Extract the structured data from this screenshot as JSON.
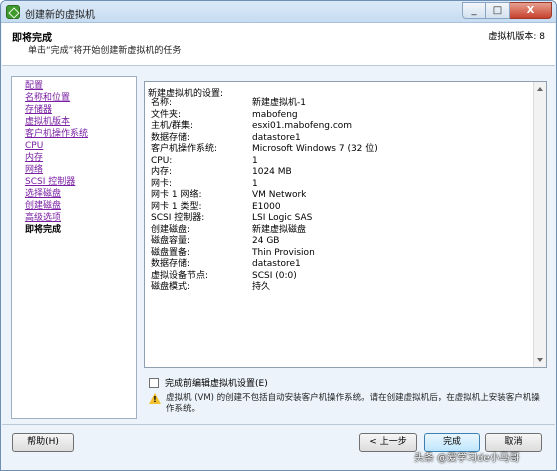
{
  "window": {
    "title": "创建新的虚拟机",
    "min_label": "_",
    "max_label": "□",
    "close_label": "X"
  },
  "header": {
    "title": "即将完成",
    "subtitle": "单击“完成”将开始创建新虚拟机的任务",
    "version": "虚拟机版本: 8"
  },
  "steps": [
    {
      "label": "配置"
    },
    {
      "label": "名称和位置"
    },
    {
      "label": "存储器"
    },
    {
      "label": "虚拟机版本"
    },
    {
      "label": "客户机操作系统"
    },
    {
      "label": "CPU"
    },
    {
      "label": "内存"
    },
    {
      "label": "网络"
    },
    {
      "label": "SCSI 控制器"
    },
    {
      "label": "选择磁盘"
    },
    {
      "label": "创建磁盘"
    },
    {
      "label": "高级选项"
    },
    {
      "label": "即将完成"
    }
  ],
  "summary": {
    "heading": "新建虚拟机的设置:",
    "rows": [
      {
        "key": "名称:",
        "value": "新建虚拟机-1"
      },
      {
        "key": "文件夹:",
        "value": "mabofeng"
      },
      {
        "key": "主机/群集:",
        "value": "esxi01.mabofeng.com"
      },
      {
        "key": "数据存储:",
        "value": "datastore1"
      },
      {
        "key": "客户机操作系统:",
        "value": "Microsoft Windows 7 (32 位)"
      },
      {
        "key": "CPU:",
        "value": "1"
      },
      {
        "key": "内存:",
        "value": "1024 MB"
      },
      {
        "key": "网卡:",
        "value": "1"
      },
      {
        "key": "网卡 1 网络:",
        "value": "VM Network"
      },
      {
        "key": "网卡 1 类型:",
        "value": "E1000"
      },
      {
        "key": "SCSI 控制器:",
        "value": "LSI Logic SAS"
      },
      {
        "key": "创建磁盘:",
        "value": "新建虚拟磁盘"
      },
      {
        "key": "磁盘容量:",
        "value": "24 GB"
      },
      {
        "key": "磁盘置备:",
        "value": "Thin Provision"
      },
      {
        "key": "数据存储:",
        "value": "datastore1"
      },
      {
        "key": "虚拟设备节点:",
        "value": "SCSI (0:0)"
      },
      {
        "key": "磁盘模式:",
        "value": "持久"
      }
    ]
  },
  "edit_checkbox": {
    "label": "完成前编辑虚拟机设置(E)",
    "checked": false
  },
  "warning": {
    "icon": "warning-icon",
    "mark": "!",
    "text": "虚拟机 (VM) 的创建不包括自动安装客户机操作系统。请在创建虚拟机后，在虚拟机上安装客户机操作系统。"
  },
  "buttons": {
    "help": "帮助(H)",
    "back": "< 上一步",
    "finish": "完成",
    "cancel": "取消"
  },
  "watermark": "头条 @爱学习de小马哥"
}
